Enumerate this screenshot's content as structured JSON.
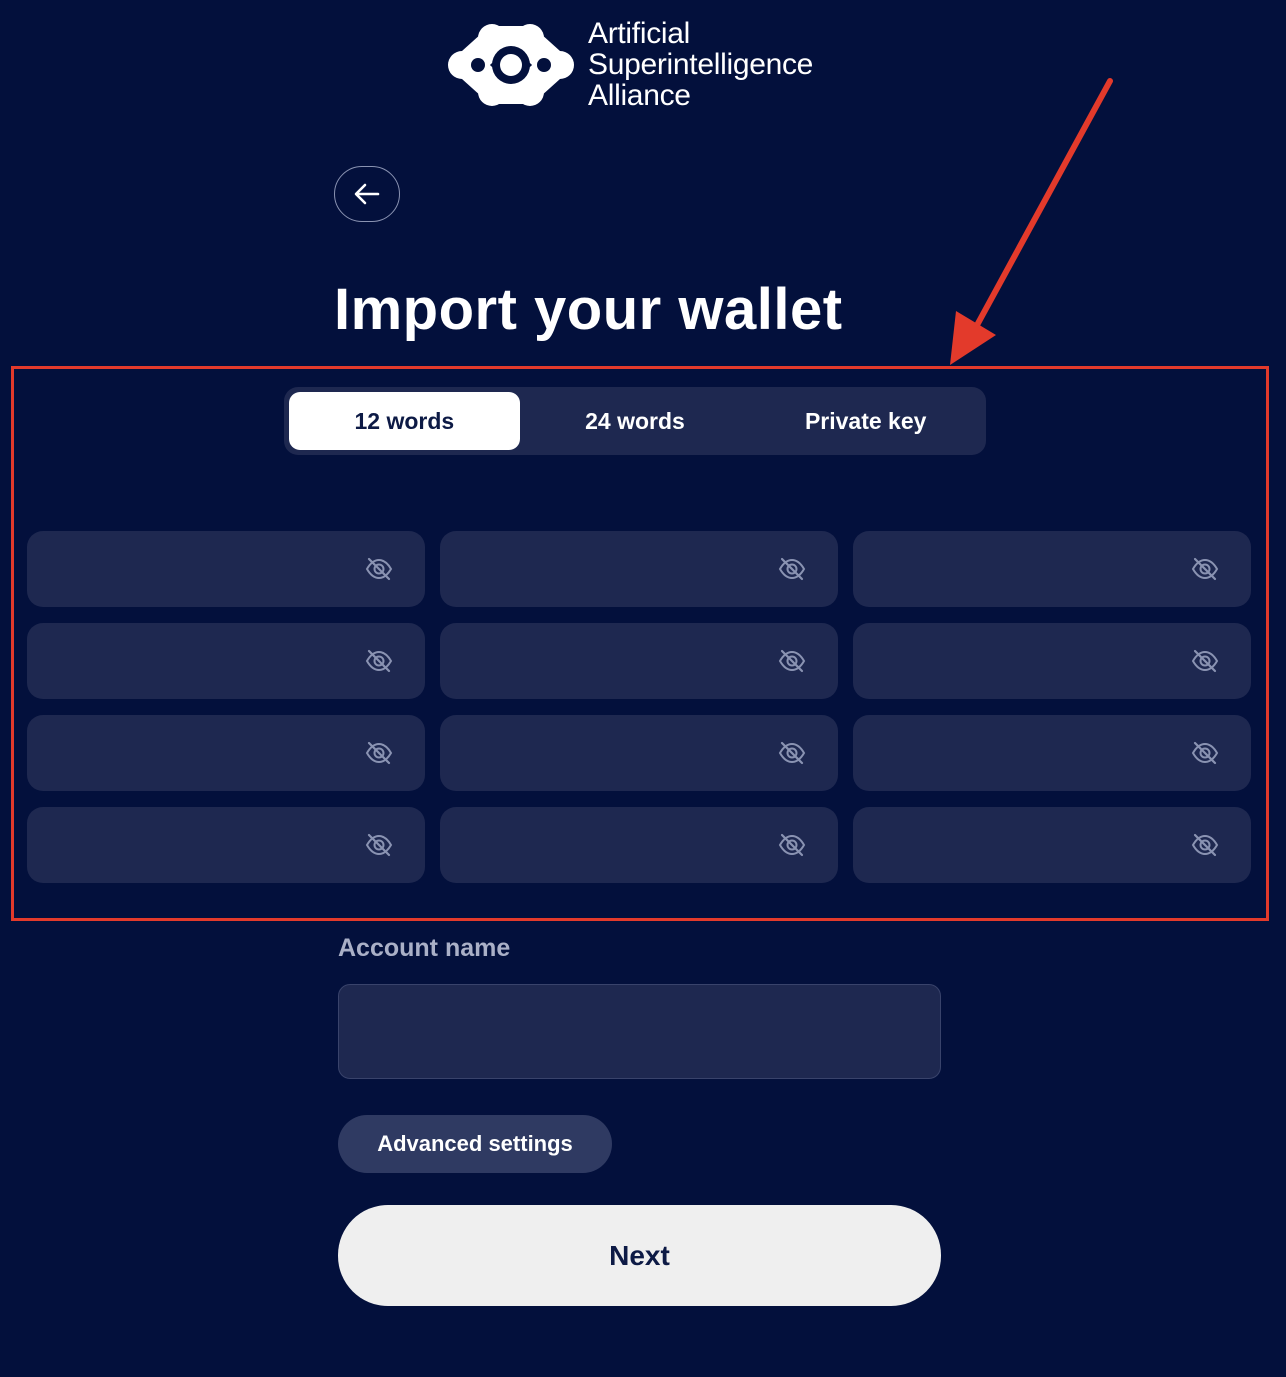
{
  "brand": {
    "name_lines": [
      "Artificial",
      "Superintelligence",
      "Alliance"
    ],
    "logo_icon": "asi-alliance-logo"
  },
  "back_icon": "arrow-left-icon",
  "title": "Import your wallet",
  "tabs": [
    {
      "label": "12 words",
      "active": true
    },
    {
      "label": "24 words",
      "active": false
    },
    {
      "label": "Private key",
      "active": false
    }
  ],
  "word_fields": [
    {
      "value": ""
    },
    {
      "value": ""
    },
    {
      "value": ""
    },
    {
      "value": ""
    },
    {
      "value": ""
    },
    {
      "value": ""
    },
    {
      "value": ""
    },
    {
      "value": ""
    },
    {
      "value": ""
    },
    {
      "value": ""
    },
    {
      "value": ""
    },
    {
      "value": ""
    }
  ],
  "visibility_icon": "eye-off-icon",
  "account": {
    "label": "Account name",
    "value": ""
  },
  "advanced_label": "Advanced settings",
  "next_label": "Next",
  "colors": {
    "background": "#03103c",
    "field": "#1e2850",
    "annotation": "#e33a2b"
  }
}
